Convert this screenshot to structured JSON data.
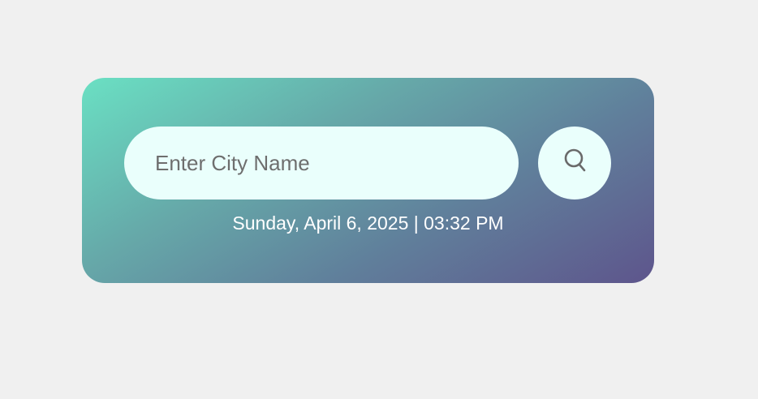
{
  "search": {
    "placeholder": "Enter City Name",
    "value": ""
  },
  "search_button": {
    "icon": "search-icon"
  },
  "datetime": {
    "text": "Sunday, April 6, 2025 | 03:32 PM"
  },
  "colors": {
    "page_background": "#f0f0f0",
    "gradient_start": "#6ae0c3",
    "gradient_end": "#5e558c",
    "field_background": "#eafffc",
    "icon": "#6a6a6a",
    "date_text": "#ffffff"
  }
}
